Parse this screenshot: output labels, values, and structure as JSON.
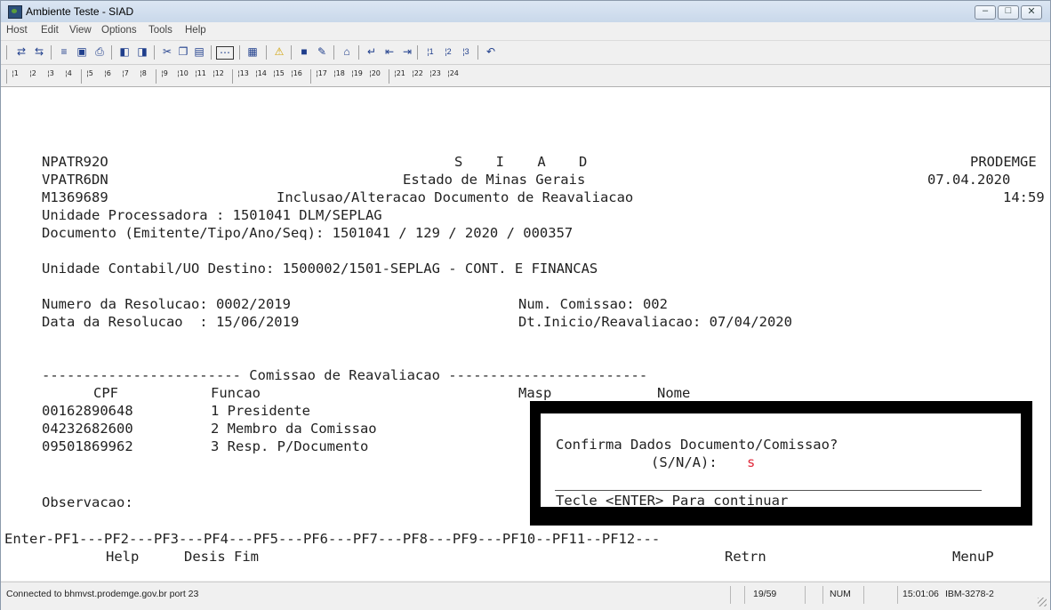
{
  "window": {
    "title": "Ambiente Teste - SIAD",
    "min_label": "–",
    "max_label": "□",
    "close_label": "✕"
  },
  "menu": [
    "Host",
    "Edit",
    "View",
    "Options",
    "Tools",
    "Help"
  ],
  "toolbar1_icons": [
    "connect-icon",
    "disconnect-icon",
    "send-icon",
    "receive-icon",
    "print-icon",
    "session-icon",
    "session2-icon",
    "cut-icon",
    "copy-icon",
    "paste-icon",
    "keypad-icon",
    "macro-icon",
    "warning-icon",
    "screen-icon",
    "edit-icon",
    "home-icon",
    "enter-icon",
    "newline-icon",
    "tab-icon",
    "pa1-icon",
    "pa2-icon",
    "pa3-icon",
    "undo-icon"
  ],
  "toolbar2_keys": [
    "1",
    "2",
    "3",
    "4",
    "5",
    "6",
    "7",
    "8",
    "9",
    "10",
    "11",
    "12",
    "13",
    "14",
    "15",
    "16",
    "17",
    "18",
    "19",
    "20",
    "21",
    "22",
    "23",
    "24"
  ],
  "screen": {
    "prog1": "NPATR92O",
    "title1": "S    I    A    D",
    "org": "PRODEMGE",
    "prog2": "VPATR6DN",
    "title2": "Estado de Minas Gerais",
    "date": "07.04.2020",
    "prog3": "M1369689",
    "title3": "Inclusao/Alteracao Documento de Reavaliacao",
    "time": "14:59",
    "unidade_proc": "Unidade Processadora : 1501041 DLM/SEPLAG",
    "documento": "Documento (Emitente/Tipo/Ano/Seq): 1501041 / 129 / 2020 / 000357",
    "unidade_contabil": "Unidade Contabil/UO Destino: 1500002/1501-SEPLAG - CONT. E FINANCAS",
    "num_resolucao": "Numero da Resolucao: 0002/2019",
    "num_comissao": "Num. Comissao: 002",
    "data_resolucao": "Data da Resolucao  : 15/06/2019",
    "dt_inicio": "Dt.Inicio/Reavaliacao: 07/04/2020",
    "comissao_header": "------------------------ Comissao de Reavaliacao ------------------------",
    "col_cpf": "CPF",
    "col_funcao": "Funcao",
    "col_masp": "Masp",
    "col_nome": "Nome",
    "rows": [
      {
        "cpf": "00162890648",
        "funcao": "1 Presidente"
      },
      {
        "cpf": "04232682600",
        "funcao": "2 Membro da Comissao"
      },
      {
        "cpf": "09501869962",
        "funcao": "3 Resp. P/Documento"
      }
    ],
    "observacao": "Observacao:",
    "pf_line": "Enter-PF1---PF2---PF3---PF4---PF5---PF6---PF7---PF8---PF9---PF10--PF11--PF12---",
    "pf_help": "Help",
    "pf_desis": "Desis",
    "pf_fim": "Fim",
    "pf_retrn": "Retrn",
    "pf_menup": "MenuP"
  },
  "popup": {
    "question": "Confirma Dados Documento/Comissao?",
    "options": "(S/N/A):",
    "answer": "s",
    "hint": "Tecle <ENTER> Para continuar"
  },
  "status": {
    "connection": "Connected to bhmvst.prodemge.gov.br port 23",
    "cursor": "19/59",
    "num": "NUM",
    "clock": "15:01:06",
    "terminal_type": "IBM-3278-2"
  }
}
